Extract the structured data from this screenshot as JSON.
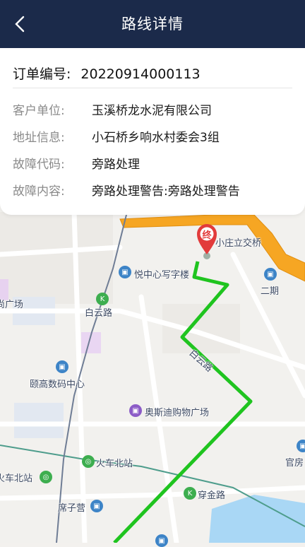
{
  "header": {
    "title": "路线详情",
    "back_icon": "chevron-left-icon"
  },
  "order": {
    "label": "订单编号:",
    "number": "20220914000113",
    "fields": [
      {
        "label": "客户单位:",
        "value": "玉溪桥龙水泥有限公司"
      },
      {
        "label": "地址信息:",
        "value": "小石桥乡响水村委会3组"
      },
      {
        "label": "故障代码:",
        "value": "旁路处理"
      },
      {
        "label": "故障内容:",
        "value": "旁路处理警告:旁路处理警告"
      }
    ]
  },
  "map": {
    "end_marker": "终",
    "labels": {
      "xiaozhuang": "小庄立交桥",
      "yuezhongxin": "悦中心写字楼",
      "erqi": "二期",
      "guangchang": "尚广场",
      "baiyunlu_station": "白云路",
      "baiyunlu_road": "白云路",
      "yigao": "颐高数码中心",
      "aosidi": "奥斯迪购物广场",
      "huochebei_station": "火车北站",
      "huochebei": "火车北站",
      "guanfang": "官房",
      "chuanjinlu": "穿金路",
      "xizi": "席子营"
    },
    "colors": {
      "route": "#1fc41f",
      "expressway": "#f6a623",
      "header": "#1b2a4a",
      "marker": "#e23b3b"
    }
  }
}
